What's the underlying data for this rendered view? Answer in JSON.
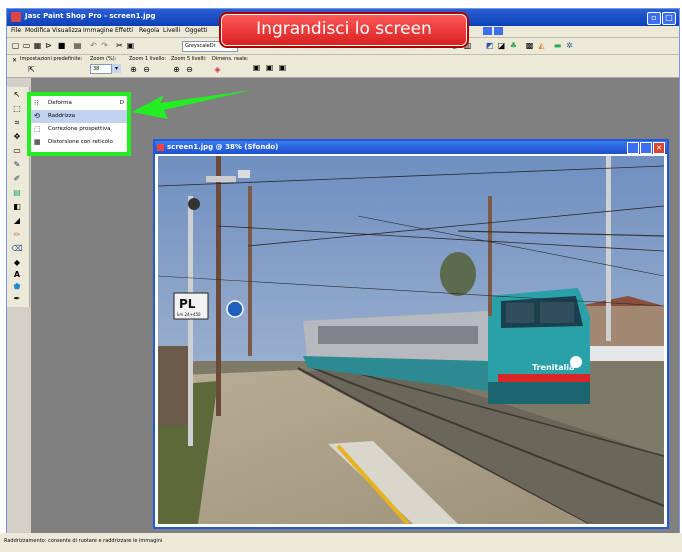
{
  "app": {
    "title": "Jasc Paint Shop Pro - screen1.jpg",
    "menu": [
      "File",
      "Modifica",
      "Visualizza",
      "Immagine",
      "Effetti",
      "Regola",
      "Livelli",
      "Oggetti"
    ],
    "toolbar_combo": "GreyscaleDr",
    "options": {
      "preset_label": "Impostazioni predefinite:",
      "zoom_percent_label": "Zoom (%):",
      "zoom_value": "38",
      "zoom_level_label": "Zoom 1 livello:",
      "zoom_5_label": "Zoom 5 livelli:",
      "size_label": "Dimens. reale:"
    },
    "tools": [
      "Puntatore",
      "Selezione",
      "Ritaglia",
      "Sposta",
      "Forma",
      "Pennello",
      "Clona",
      "Riempimento",
      "Gomma",
      "Testo",
      "Contagocce",
      "Ritocco",
      "Colore",
      "Lente"
    ]
  },
  "callout": {
    "text": "Ingrandisci lo screen"
  },
  "flyout": {
    "items": [
      {
        "label": "Deforma",
        "shortcut": "D",
        "icon": "deform-icon",
        "highlighted": false
      },
      {
        "label": "Raddrizza",
        "shortcut": "",
        "icon": "straighten-icon",
        "highlighted": true
      },
      {
        "label": "Correzione prospettiva",
        "shortcut": "",
        "icon": "perspective-icon",
        "highlighted": false
      },
      {
        "label": "Distorsione con reticolo",
        "shortcut": "",
        "icon": "mesh-warp-icon",
        "highlighted": false
      }
    ]
  },
  "image_window": {
    "title": "screen1.jpg @ 38% (Sfondo)"
  },
  "photo": {
    "sign_text": "PL",
    "sign_subtext": "km 24+450",
    "train_logo": "Trenitalia"
  },
  "status": {
    "text": "Raddrizzamento: consente di ruotare e raddrizzare le immagini"
  },
  "colors": {
    "highlight": "#22ee22",
    "callout": "#e02828",
    "title_blue": "#2159d8"
  }
}
